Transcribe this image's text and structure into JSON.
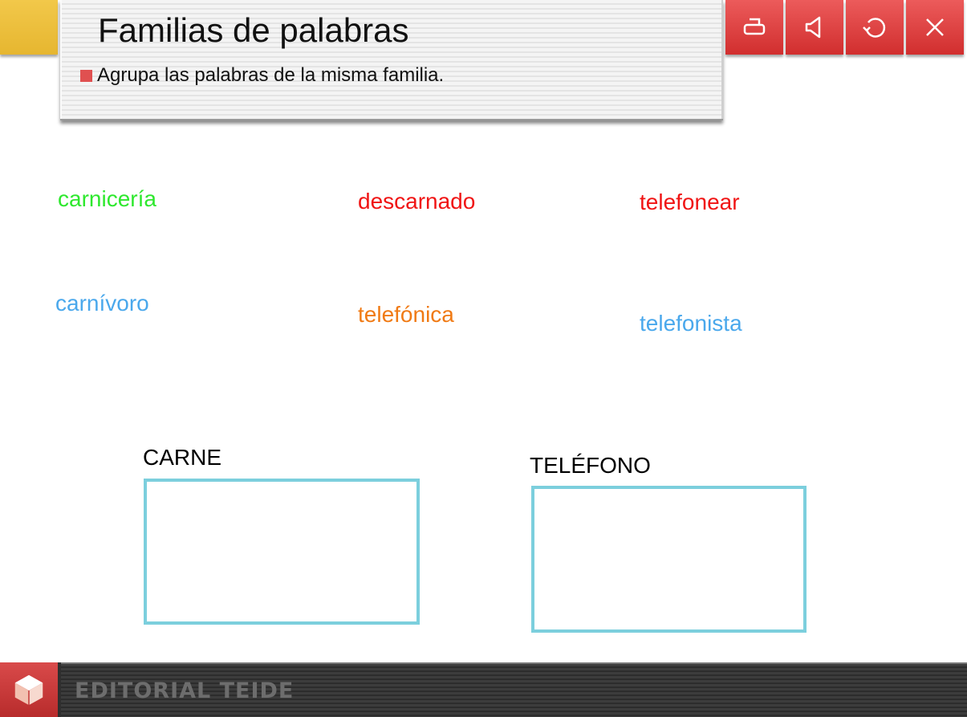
{
  "header": {
    "title": "Familias de palabras",
    "instruction": "Agrupa las palabras de la misma familia."
  },
  "toolbar": {
    "buttons": [
      {
        "icon": "print-icon"
      },
      {
        "icon": "speaker-icon"
      },
      {
        "icon": "reload-icon"
      },
      {
        "icon": "close-icon"
      }
    ]
  },
  "words": [
    {
      "text": "carnicería",
      "color": "#2ee82e"
    },
    {
      "text": "descarnado",
      "color": "#f01414"
    },
    {
      "text": "telefonear",
      "color": "#f01414"
    },
    {
      "text": "carnívoro",
      "color": "#4aa8ec"
    },
    {
      "text": "telefónica",
      "color": "#f07a14"
    },
    {
      "text": "telefonista",
      "color": "#4aa8ec"
    }
  ],
  "groups": [
    {
      "label": "CARNE"
    },
    {
      "label": "TELÉFONO"
    }
  ],
  "footer": {
    "brand": "EDITORIAL TEIDE"
  },
  "colors": {
    "accent_red": "#d83a3a",
    "drop_border": "#7ccfdd",
    "tab_yellow": "#ecc03c"
  }
}
